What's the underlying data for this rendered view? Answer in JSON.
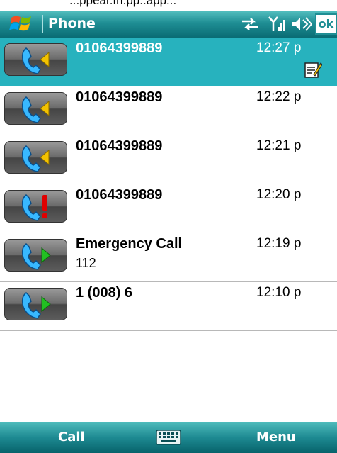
{
  "top_strip_text": "...ppear.fn.pp..app...",
  "title_bar": {
    "app_title": "Phone",
    "ok_label": "ok",
    "icons": [
      "windows-start-icon",
      "connectivity-icon",
      "signal-icon",
      "volume-icon"
    ]
  },
  "call_log": [
    {
      "name": "01064399889",
      "detail": "",
      "time": "12:27 p",
      "type": "incoming",
      "selected": true,
      "has_note": true
    },
    {
      "name": "01064399889",
      "detail": "",
      "time": "12:22 p",
      "type": "incoming",
      "selected": false,
      "has_note": false
    },
    {
      "name": "01064399889",
      "detail": "",
      "time": "12:21 p",
      "type": "incoming",
      "selected": false,
      "has_note": false
    },
    {
      "name": "01064399889",
      "detail": "",
      "time": "12:20 p",
      "type": "missed",
      "selected": false,
      "has_note": false
    },
    {
      "name": "Emergency Call",
      "detail": "112",
      "time": "12:19 p",
      "type": "outgoing",
      "selected": false,
      "has_note": false
    },
    {
      "name": "1 (008) 6",
      "detail": "",
      "time": "12:10 p",
      "type": "outgoing",
      "selected": false,
      "has_note": false
    }
  ],
  "softkeys": {
    "left_label": "Call",
    "right_label": "Menu",
    "center_icon": "keyboard-icon"
  },
  "colors": {
    "title_bar": "#1f8e94",
    "selected_row": "#27b2be",
    "incoming_arrow": "#f2c200",
    "missed_marker": "#e00000",
    "outgoing_arrow": "#22c022",
    "handset": "#38b8ff"
  }
}
